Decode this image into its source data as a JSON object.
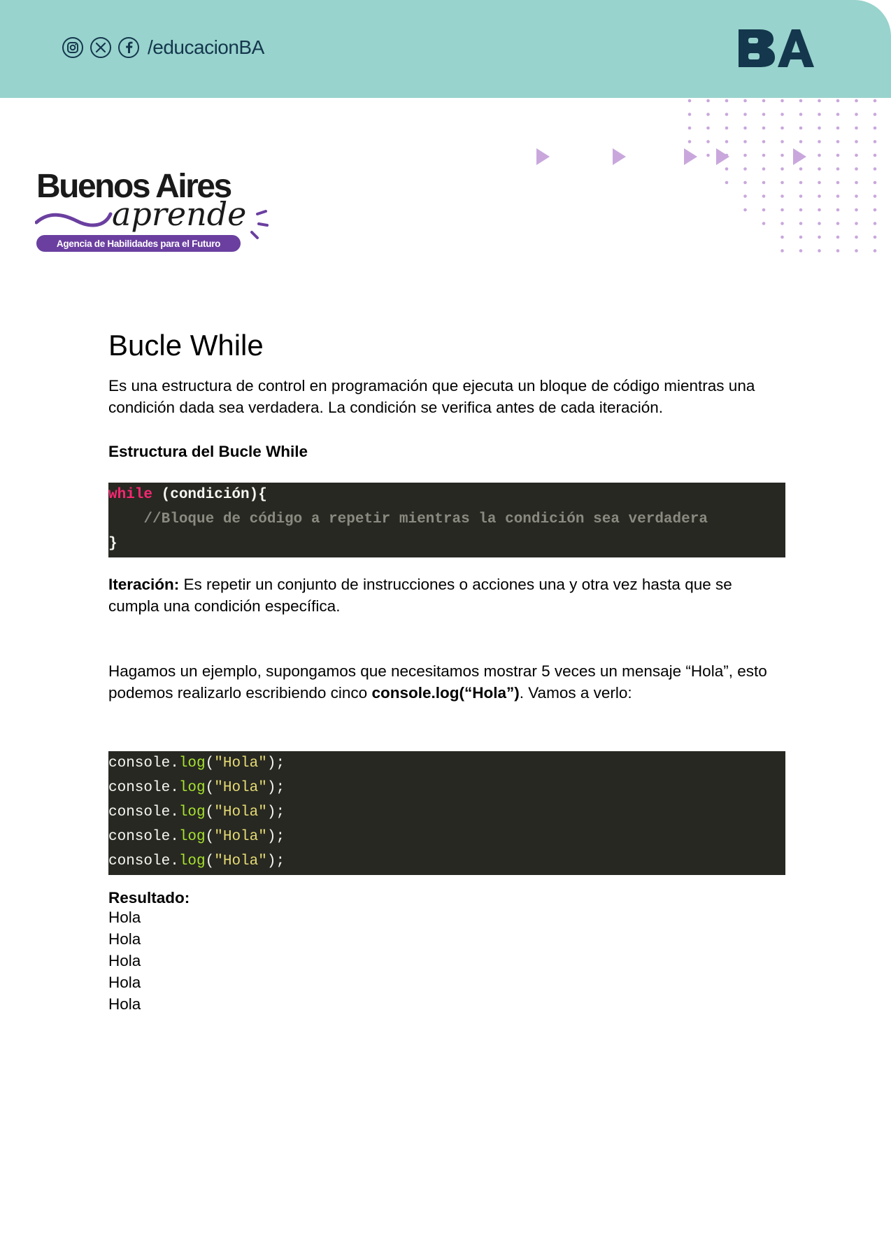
{
  "header": {
    "social_icons": [
      "instagram-icon",
      "x-icon",
      "facebook-icon"
    ],
    "handle": "/educacionBA",
    "logo_text": "BA",
    "band_color": "#98d3cd",
    "ink_color": "#14374d"
  },
  "brand": {
    "line1": "Buenos Aires",
    "line2": "aprende",
    "tagline": "Agencia de Habilidades para el Futuro",
    "accent_color": "#6b3fa0"
  },
  "document": {
    "title": "Bucle While",
    "intro": "Es una estructura de control en programación que ejecuta un bloque de código mientras una condición dada sea verdadera. La condición se verifica antes de cada iteración.",
    "structure_heading": "Estructura del Bucle While",
    "code_block_1": {
      "keyword": "while",
      "condition": " (condición){",
      "comment": "    //Bloque de código a repetir mientras la condición sea verdadera",
      "closing": "}"
    },
    "iteration_term": "Iteración:",
    "iteration_text": " Es repetir un conjunto de instrucciones o acciones una y otra vez hasta que se cumpla una condición específica.",
    "example_text_a": "Hagamos un ejemplo, supongamos que necesitamos mostrar 5 veces un mensaje  “Hola”, esto podemos realizarlo escribiendo cinco ",
    "example_code_inline": "console.log(“Hola”)",
    "example_text_b": ". Vamos a verlo:",
    "code_block_2": {
      "lines": [
        {
          "obj": "console.",
          "fn": "log",
          "open": "(",
          "str": "\"Hola\"",
          "close": ");"
        },
        {
          "obj": "console.",
          "fn": "log",
          "open": "(",
          "str": "\"Hola\"",
          "close": ");"
        },
        {
          "obj": "console.",
          "fn": "log",
          "open": "(",
          "str": "\"Hola\"",
          "close": ");"
        },
        {
          "obj": "console.",
          "fn": "log",
          "open": "(",
          "str": "\"Hola\"",
          "close": ");"
        },
        {
          "obj": "console.",
          "fn": "log",
          "open": "(",
          "str": "\"Hola\"",
          "close": ");"
        }
      ]
    },
    "result_heading": "Resultado:",
    "results": [
      "Hola",
      "Hola",
      "Hola",
      "Hola",
      "Hola"
    ]
  },
  "colors": {
    "code_bg": "#272822",
    "keyword": "#f92672",
    "function": "#a6e22e",
    "string": "#e6db74",
    "comment": "#8a8a80",
    "decor_purple": "#c9a7dc"
  }
}
